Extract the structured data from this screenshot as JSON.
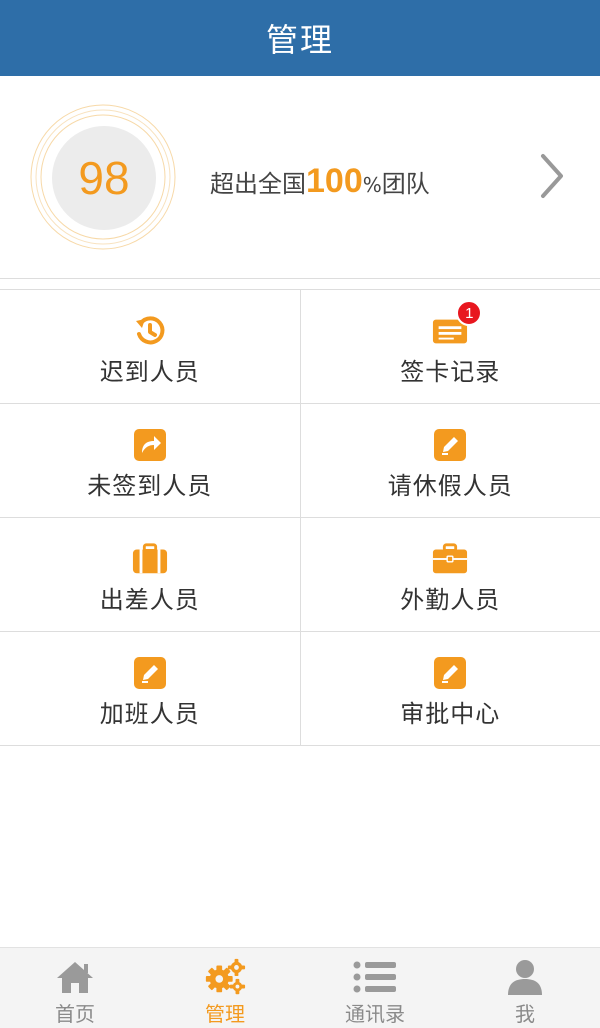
{
  "header": {
    "title": "管理"
  },
  "score": {
    "value": "98",
    "desc_prefix": "超出全国",
    "desc_percent": "100",
    "desc_percent_sign": "%",
    "desc_suffix": "团队"
  },
  "colors": {
    "header_bg": "#2e6ea8",
    "accent": "#f39a1f",
    "badge": "#e8171f"
  },
  "grid": {
    "items": [
      {
        "label": "迟到人员",
        "icon": "late-clock-icon"
      },
      {
        "label": "签卡记录",
        "icon": "card-record-icon",
        "badge": "1"
      },
      {
        "label": "未签到人员",
        "icon": "share-arrow-icon"
      },
      {
        "label": "请休假人员",
        "icon": "edit-pencil-icon"
      },
      {
        "label": "出差人员",
        "icon": "luggage-icon"
      },
      {
        "label": "外勤人员",
        "icon": "briefcase-icon"
      },
      {
        "label": "加班人员",
        "icon": "edit-pencil-icon"
      },
      {
        "label": "审批中心",
        "icon": "edit-pencil-icon"
      }
    ]
  },
  "tabbar": {
    "tabs": [
      {
        "label": "首页",
        "icon": "home-icon",
        "active": false
      },
      {
        "label": "管理",
        "icon": "gears-icon",
        "active": true
      },
      {
        "label": "通讯录",
        "icon": "list-icon",
        "active": false
      },
      {
        "label": "我",
        "icon": "person-icon",
        "active": false
      }
    ]
  }
}
